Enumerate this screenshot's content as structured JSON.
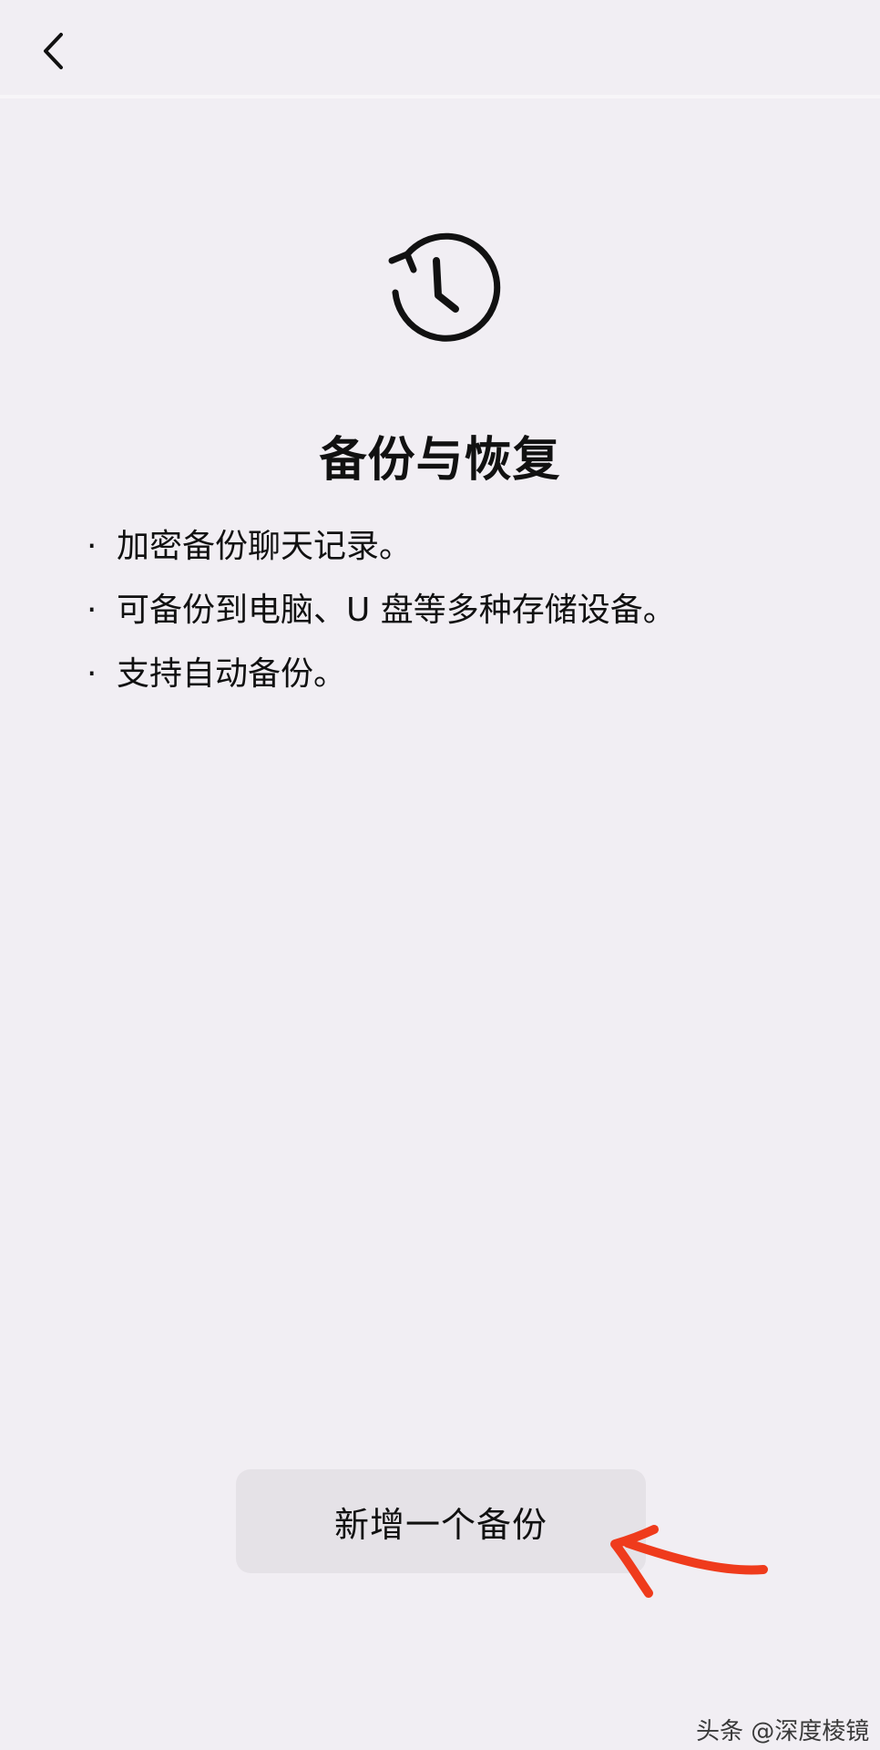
{
  "header": {
    "back_icon": "chevron-left-icon"
  },
  "hero": {
    "icon": "restore-history-clock-icon",
    "title": "备份与恢复"
  },
  "features": {
    "bullet": "·",
    "items": [
      "加密备份聊天记录。",
      "可备份到电脑、U 盘等多种存储设备。",
      "支持自动备份。"
    ]
  },
  "actions": {
    "add_backup_label": "新增一个备份"
  },
  "annotation": {
    "arrow_icon": "red-hand-drawn-arrow-icon",
    "arrow_color": "#ef3b1c"
  },
  "watermark": {
    "text": "头条 @深度棱镜"
  },
  "colors": {
    "background": "#f1eef3",
    "button_background": "#e5e2e7",
    "text": "#111111"
  }
}
